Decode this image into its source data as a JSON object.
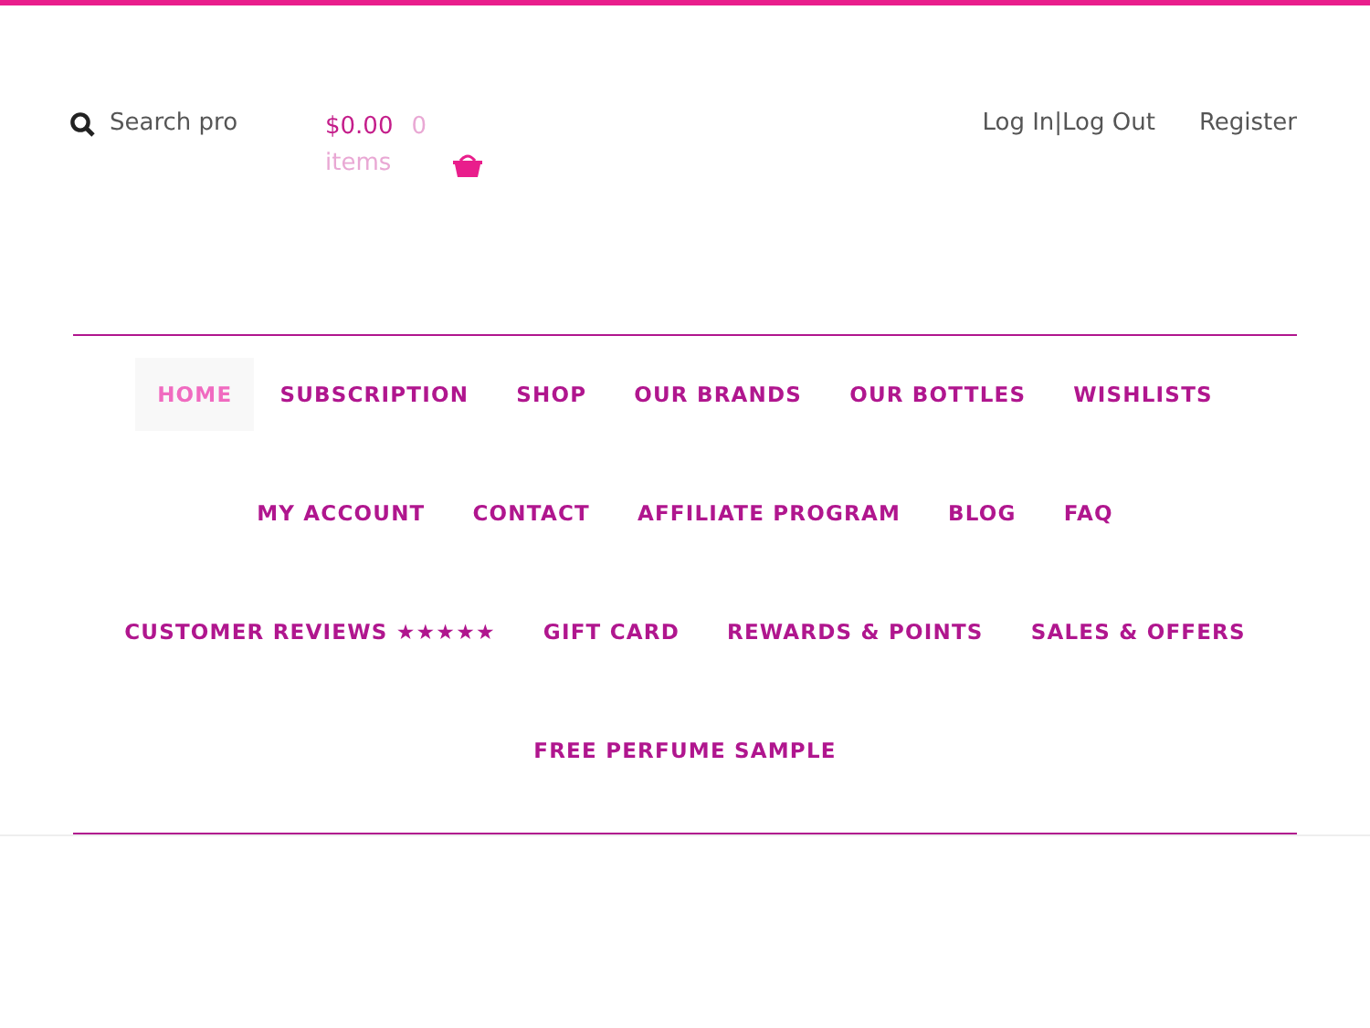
{
  "search": {
    "placeholder": "Search pro"
  },
  "cart": {
    "total": "$0.00",
    "count": "0",
    "count_unit": "items"
  },
  "account_links": [
    "Log In|Log Out",
    "Register"
  ],
  "nav": {
    "items": [
      {
        "label": "HOME",
        "selected": true
      },
      {
        "label": "SUBSCRIPTION",
        "selected": false
      },
      {
        "label": "SHOP",
        "selected": false
      },
      {
        "label": "OUR BRANDS",
        "selected": false
      },
      {
        "label": "OUR BOTTLES",
        "selected": false
      },
      {
        "label": "WISHLISTS",
        "selected": false
      },
      {
        "label": "MY ACCOUNT",
        "selected": false
      },
      {
        "label": "CONTACT",
        "selected": false
      },
      {
        "label": "AFFILIATE PROGRAM",
        "selected": false
      },
      {
        "label": "BLOG",
        "selected": false
      },
      {
        "label": "FAQ",
        "selected": false
      },
      {
        "label": "CUSTOMER REVIEWS ★★★★★",
        "selected": false
      },
      {
        "label": "GIFT CARD",
        "selected": false
      },
      {
        "label": "REWARDS & POINTS",
        "selected": false
      },
      {
        "label": "SALES & OFFERS",
        "selected": false
      },
      {
        "label": "FREE PERFUME SAMPLE",
        "selected": false
      }
    ]
  }
}
